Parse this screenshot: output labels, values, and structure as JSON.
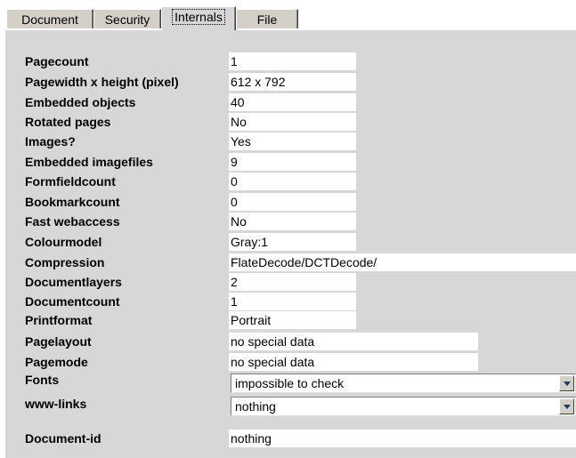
{
  "tabs": [
    {
      "label": "Document"
    },
    {
      "label": "Security"
    },
    {
      "label": "Internals"
    },
    {
      "label": "File"
    }
  ],
  "fields": {
    "pagecount": {
      "label": "Pagecount",
      "value": "1"
    },
    "pagesize": {
      "label": "Pagewidth x height (pixel)",
      "value": "612 x 792"
    },
    "embedded_objects": {
      "label": "Embedded objects",
      "value": "40"
    },
    "rotated_pages": {
      "label": "Rotated pages",
      "value": "No"
    },
    "images": {
      "label": "Images?",
      "value": "Yes"
    },
    "embedded_imagefiles": {
      "label": "Embedded imagefiles",
      "value": "9"
    },
    "formfieldcount": {
      "label": "Formfieldcount",
      "value": "0"
    },
    "bookmarkcount": {
      "label": "Bookmarkcount",
      "value": "0"
    },
    "fast_webaccess": {
      "label": "Fast webaccess",
      "value": "No"
    },
    "colourmodel": {
      "label": "Colourmodel",
      "value": "Gray:1"
    },
    "compression": {
      "label": "Compression",
      "value": "FlateDecode/DCTDecode/"
    },
    "documentlayers": {
      "label": "Documentlayers",
      "value": "2"
    },
    "documentcount": {
      "label": "Documentcount",
      "value": "1"
    },
    "printformat": {
      "label": "Printformat",
      "value": "Portrait"
    },
    "pagelayout": {
      "label": "Pagelayout",
      "value": "no special data"
    },
    "pagemode": {
      "label": "Pagemode",
      "value": "no special data"
    },
    "fonts": {
      "label": "Fonts",
      "value": "impossible to check"
    },
    "www_links": {
      "label": "www-links",
      "value": "nothing"
    },
    "document_id": {
      "label": "Document-id",
      "value": "nothing"
    }
  }
}
